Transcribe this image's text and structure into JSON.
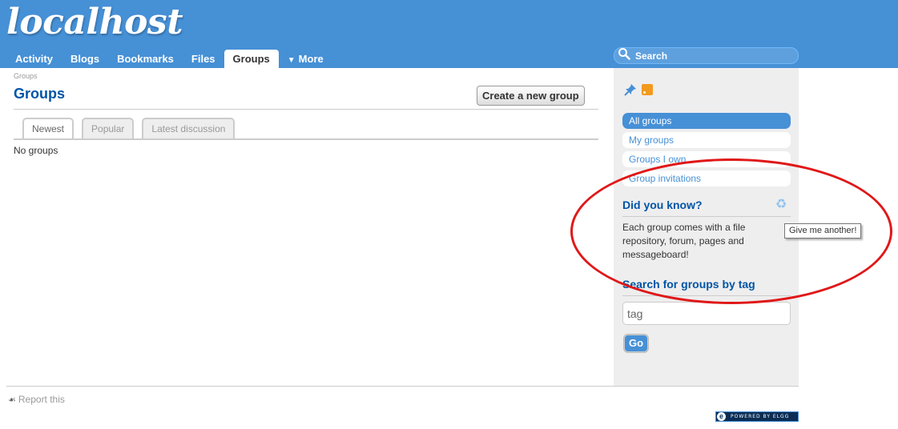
{
  "header": {
    "site_name": "localhost",
    "nav": [
      {
        "label": "Activity"
      },
      {
        "label": "Blogs"
      },
      {
        "label": "Bookmarks"
      },
      {
        "label": "Files"
      },
      {
        "label": "Groups",
        "active": true
      },
      {
        "label": "More",
        "icon": "dropdown-triangle-icon"
      }
    ],
    "search_placeholder": "Search",
    "search_icon": "magnifier-icon"
  },
  "main": {
    "breadcrumb": "Groups",
    "title": "Groups",
    "create_button": "Create a new group",
    "tabs": [
      {
        "label": "Newest",
        "active": true
      },
      {
        "label": "Popular"
      },
      {
        "label": "Latest discussion"
      }
    ],
    "empty_text": "No groups"
  },
  "sidebar": {
    "icons": [
      "pin-icon",
      "rss-icon"
    ],
    "menu": [
      {
        "label": "All groups",
        "active": true
      },
      {
        "label": "My groups"
      },
      {
        "label": "Groups I own"
      },
      {
        "label": "Group invitations"
      }
    ],
    "did_you_know": {
      "title": "Did you know?",
      "text": "Each group comes with a file repository, forum, pages and messageboard!",
      "refresh_icon": "recycle-icon",
      "tooltip": "Give me another!"
    },
    "tag_search": {
      "title": "Search for groups by tag",
      "input_value": "tag",
      "button": "Go"
    }
  },
  "footer": {
    "report": "Report this",
    "powered": "POWERED BY ELGG",
    "powered_logo": "e"
  },
  "colors": {
    "header_bg": "#4690d6",
    "title_blue": "#0054a7",
    "annotation_red": "#e01818"
  }
}
